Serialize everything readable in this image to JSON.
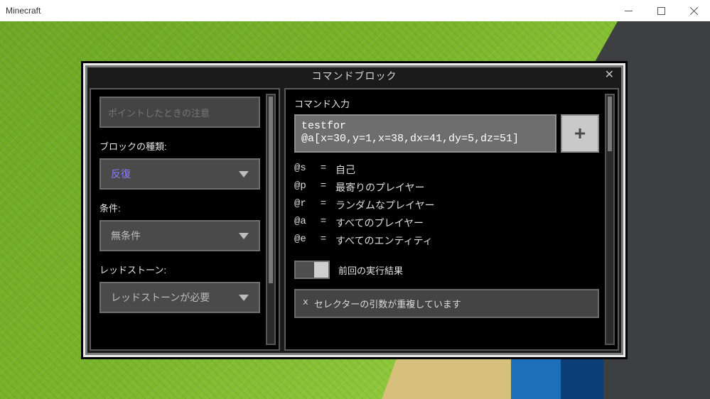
{
  "window": {
    "title": "Minecraft"
  },
  "dialog": {
    "title": "コマンドブロック",
    "hover_placeholder": "ポイントしたときの注意",
    "fields": {
      "block_type": {
        "label": "ブロックの種類:",
        "value": "反復"
      },
      "condition": {
        "label": "条件:",
        "value": "無条件"
      },
      "redstone": {
        "label": "レッドストーン:",
        "value": "レッドストーンが必要"
      }
    },
    "command": {
      "label": "コマンド入力",
      "value": "testfor @a[x=30,y=1,x=38,dx=41,dy=5,dz=51]"
    },
    "selectors": [
      {
        "k": "@s",
        "v": "自己"
      },
      {
        "k": "@p",
        "v": "最寄りのプレイヤー"
      },
      {
        "k": "@r",
        "v": "ランダムなプレイヤー"
      },
      {
        "k": "@a",
        "v": "すべてのプレイヤー"
      },
      {
        "k": "@e",
        "v": "すべてのエンティティ"
      }
    ],
    "prev_result_label": "前回の実行結果",
    "error": {
      "mark": "x",
      "text": "セレクターの引数が重複しています"
    }
  }
}
